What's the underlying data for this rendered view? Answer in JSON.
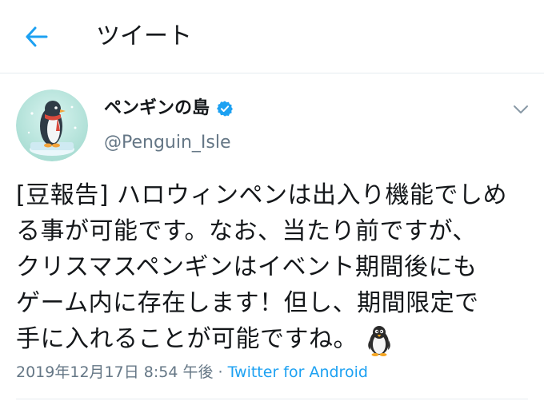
{
  "header": {
    "title": "ツイート"
  },
  "tweet": {
    "display_name": "ペンギンの島",
    "handle": "@Penguin_Isle",
    "verified": true,
    "lines": [
      "[豆報告] ハロウィンペンは出入り機能でしめ",
      "る事が可能です。なお、当たり前ですが、",
      "クリスマスペンギンはイベント期間後にも",
      "ゲーム内に存在します！但し、期間限定で",
      "手に入れることが可能ですね。"
    ],
    "emoji": "penguin",
    "timestamp": "2019年12月17日 8:54 午後 · ",
    "source": "Twitter for Android"
  },
  "colors": {
    "accent": "#1da1f2",
    "secondary_text": "#657786",
    "divider": "#e6ecf0"
  },
  "icons": {
    "back": "arrow-left-icon",
    "verified": "verified-badge-icon",
    "menu": "chevron-down-icon"
  }
}
